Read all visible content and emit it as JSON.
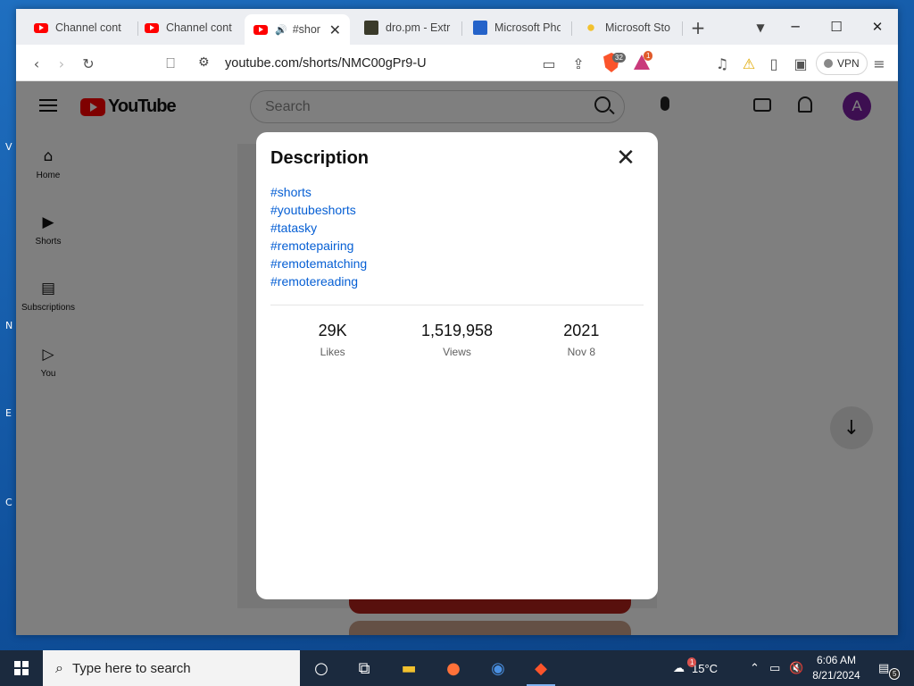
{
  "browser": {
    "tabs": [
      {
        "label": "Channel conte",
        "favicon": "youtube-icon",
        "active": false
      },
      {
        "label": "Channel conte",
        "favicon": "youtube-icon",
        "active": false
      },
      {
        "label": "#shor",
        "favicon": "youtube-icon",
        "active": true,
        "audio": true
      },
      {
        "label": "dro.pm - Extr",
        "favicon": "dro-icon",
        "active": false
      },
      {
        "label": "Microsoft Pho",
        "favicon": "microsoft-icon",
        "active": false
      },
      {
        "label": "Microsoft Sto",
        "favicon": "store-icon",
        "active": false
      }
    ],
    "url": "youtube.com/shorts/NMC00gPr9-U",
    "brave_shields_badge": "32",
    "rewards_badge": "1",
    "vpn_label": "VPN"
  },
  "youtube": {
    "logo_text": "YouTube",
    "search_placeholder": "Search",
    "avatar_letter": "A",
    "sidebar": [
      {
        "label": "Home",
        "icon": "home-icon"
      },
      {
        "label": "Shorts",
        "icon": "shorts-icon"
      },
      {
        "label": "Subscriptions",
        "icon": "subscriptions-icon"
      },
      {
        "label": "You",
        "icon": "you-icon"
      }
    ]
  },
  "dialog": {
    "title": "Description",
    "tags": [
      "#shorts",
      "#youtubeshorts",
      "#tatasky",
      "#remotepairing",
      "#remotematching",
      "#remotereading"
    ],
    "stats": [
      {
        "value": "29K",
        "label": "Likes"
      },
      {
        "value": "1,519,958",
        "label": "Views"
      },
      {
        "value": "2021",
        "label": "Nov 8"
      }
    ]
  },
  "taskbar": {
    "search_placeholder": "Type here to search",
    "weather": "15°C",
    "weather_badge": "1",
    "time": "6:06 AM",
    "date": "8/21/2024",
    "notification_count": "5"
  }
}
